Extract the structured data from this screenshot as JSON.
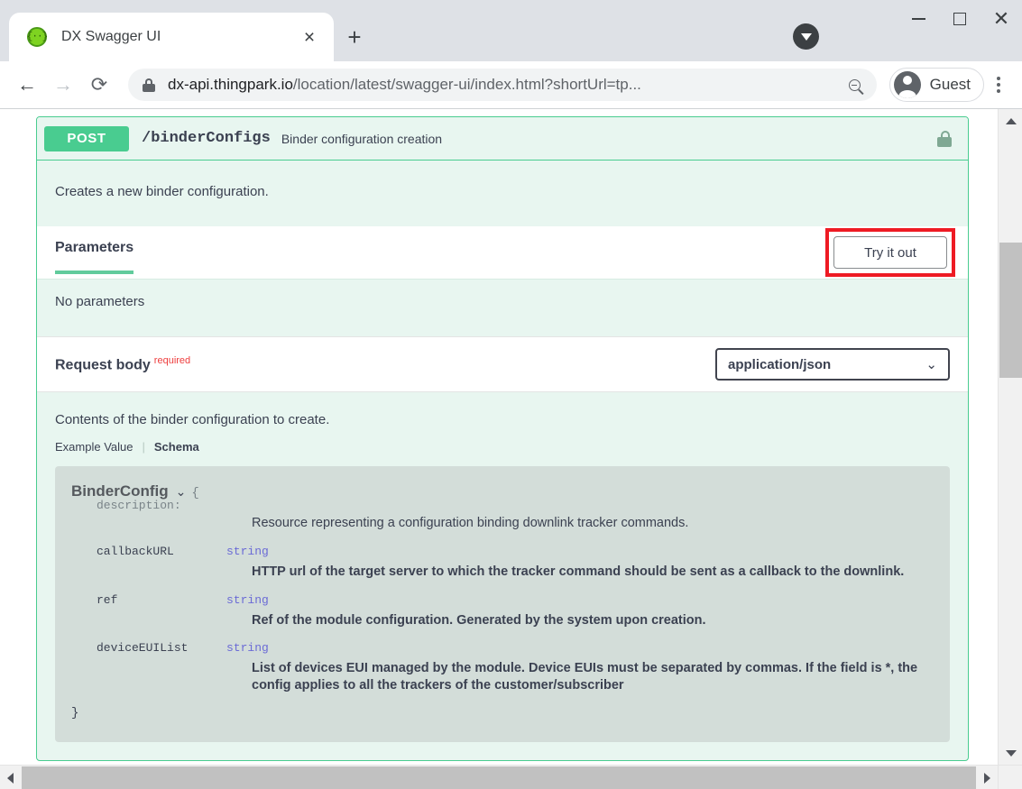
{
  "browser": {
    "tab": {
      "title": "DX Swagger UI",
      "favicon_icon": "swagger-braces-icon",
      "close_icon": "×"
    },
    "new_tab_icon": "+",
    "download_indicator_icon": "download-arrow-icon",
    "window_controls": {
      "minimize": "minimize-icon",
      "maximize": "maximize-icon",
      "close": "✕"
    },
    "toolbar": {
      "back_icon": "←",
      "forward_icon": "→",
      "reload_icon": "⟳",
      "site_lock_icon": "padlock-icon",
      "url_domain": "dx-api.thingpark.io",
      "url_path": "/location/latest/swagger-ui/index.html?shortUrl=tp...",
      "zoom_out_icon": "zoom-out-icon",
      "profile_name": "Guest",
      "menu_icon": "kebab-menu-icon"
    }
  },
  "operation": {
    "method": "POST",
    "path": "/binderConfigs",
    "summary": "Binder configuration creation",
    "auth_icon": "unlocked-padlock-icon",
    "description": "Creates a new binder configuration.",
    "parameters": {
      "title": "Parameters",
      "try_it_out_label": "Try it out",
      "empty_text": "No parameters",
      "highlight_color": "#ee1b24"
    },
    "request_body": {
      "label": "Request body",
      "required_label": "required",
      "content_type": "application/json",
      "chevron_icon": "⌄",
      "description": "Contents of the binder configuration to create.",
      "tabs": {
        "example_value": "Example Value",
        "separator": "|",
        "schema": "Schema",
        "active": "Schema"
      }
    },
    "schema": {
      "model_name": "BinderConfig",
      "toggle_icon": "⌄",
      "open_brace": "{",
      "close_brace": "}",
      "description_label": "description:",
      "description_value": "Resource representing a configuration binding downlink tracker commands.",
      "properties": [
        {
          "name": "callbackURL",
          "type": "string",
          "doc": "HTTP url of the target server to which the tracker command should be sent as a callback to the downlink."
        },
        {
          "name": "ref",
          "type": "string",
          "doc": "Ref of the module configuration. Generated by the system upon creation."
        },
        {
          "name": "deviceEUIList",
          "type": "string",
          "doc": "List of devices EUI managed by the module. Device EUIs must be separated by commas. If the field is *, the config applies to all the trackers of the customer/subscriber"
        }
      ]
    }
  },
  "colors": {
    "method_green": "#49cc90",
    "opblock_bg": "#e8f6f0",
    "schema_bg": "#d3ddd9",
    "type_blue": "#6b6bd6",
    "required_red": "#ee3e3e",
    "highlight_red": "#ee1b24"
  }
}
